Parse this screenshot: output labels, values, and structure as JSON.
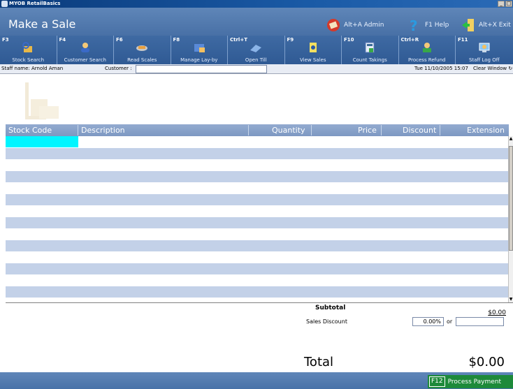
{
  "window": {
    "title": "MYOB RetailBasics",
    "min": "_",
    "max": "□"
  },
  "header": {
    "page_title": "Make a Sale",
    "admin": "Alt+A Admin",
    "help": "F1 Help",
    "exit": "Alt+X Exit"
  },
  "toolbar": [
    {
      "key": "F3",
      "label": "Stock Search",
      "icon": "stock-search-icon"
    },
    {
      "key": "F4",
      "label": "Customer Search",
      "icon": "customer-search-icon"
    },
    {
      "key": "F6",
      "label": "Read Scales",
      "icon": "scales-icon"
    },
    {
      "key": "F8",
      "label": "Manage Lay-by",
      "icon": "layby-icon"
    },
    {
      "key": "Ctrl+T",
      "label": "Open Till",
      "icon": "till-icon"
    },
    {
      "key": "F9",
      "label": "View Sales",
      "icon": "view-sales-icon"
    },
    {
      "key": "F10",
      "label": "Count Takings",
      "icon": "count-takings-icon"
    },
    {
      "key": "Ctrl+R",
      "label": "Process Refund",
      "icon": "refund-icon"
    },
    {
      "key": "F11",
      "label": "Staff Log Off",
      "icon": "log-off-icon"
    }
  ],
  "staffbar": {
    "staff": "Staff name: Arnold Aman",
    "customer_label": "Customer :",
    "customer_value": "",
    "datetime": "Tue 11/10/2005 15:07",
    "clear": "Clear Window"
  },
  "table": {
    "columns": [
      "Stock Code",
      "Description",
      "Quantity",
      "Price",
      "Discount",
      "Extension"
    ]
  },
  "totals": {
    "subtotal_label": "Subtotal",
    "subtotal_value": "$0.00",
    "discount_label": "Sales Discount",
    "discount_pct": "0.00%",
    "or": "or",
    "discount_amount": "",
    "total_label": "Total",
    "total_value": "$0.00"
  },
  "footer": {
    "pay_key": "F12",
    "pay_label": "Process Payment"
  },
  "colors": {
    "header": "#4870a6",
    "toolbar": "#2f5a94",
    "row_alt": "#c3d1e8",
    "active_cell": "#00f5ff",
    "pay": "#1d8a3a"
  }
}
